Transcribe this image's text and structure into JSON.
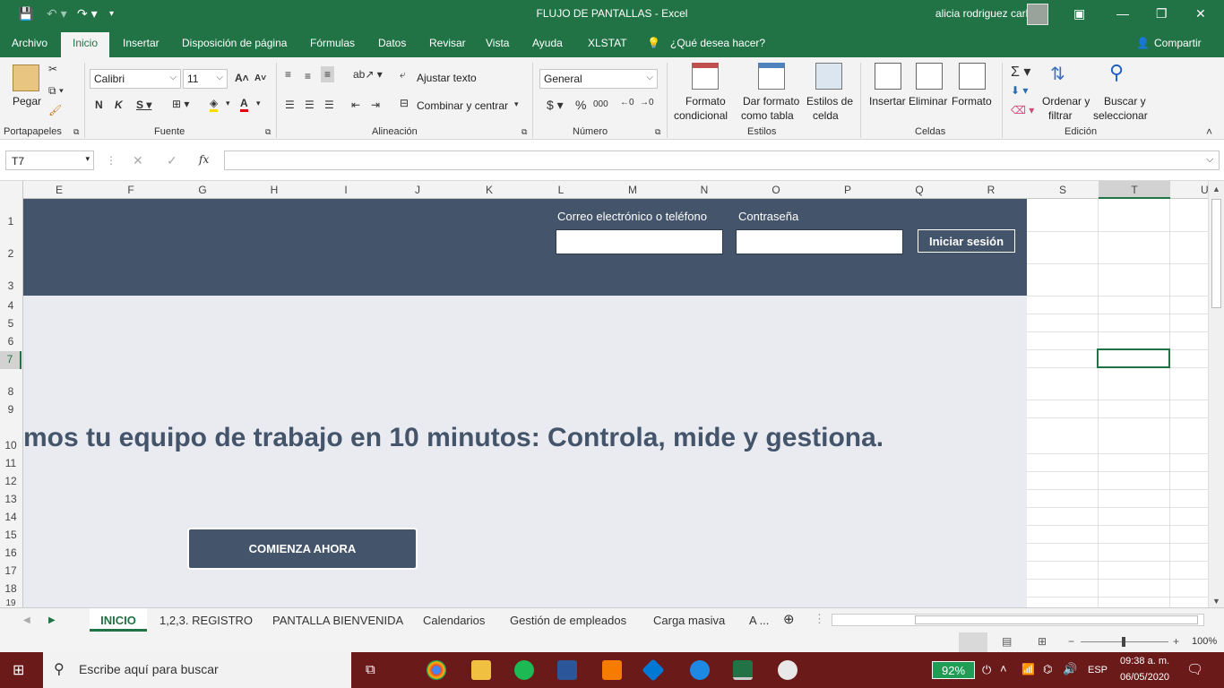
{
  "window": {
    "title": "FLUJO DE PANTALLAS  -  Excel",
    "user": "alicia rodriguez carbajal"
  },
  "menu": {
    "items": [
      "Archivo",
      "Inicio",
      "Insertar",
      "Disposición de página",
      "Fórmulas",
      "Datos",
      "Revisar",
      "Vista",
      "Ayuda",
      "XLSTAT"
    ],
    "search": "¿Qué desea hacer?",
    "share": "Compartir"
  },
  "ribbon": {
    "paste": "Pegar",
    "group_clipboard": "Portapapeles",
    "font_name": "Calibri",
    "font_size": "11",
    "group_font": "Fuente",
    "wrap_text": "Ajustar texto",
    "merge_center": "Combinar y centrar",
    "group_align": "Alineación",
    "number_format": "General",
    "group_number": "Número",
    "cond_format_1": "Formato",
    "cond_format_2": "condicional",
    "table_format_1": "Dar formato",
    "table_format_2": "como tabla",
    "cell_styles_1": "Estilos de",
    "cell_styles_2": "celda",
    "group_styles": "Estilos",
    "insert": "Insertar",
    "delete": "Eliminar",
    "format": "Formato",
    "group_cells": "Celdas",
    "sort_1": "Ordenar y",
    "sort_2": "filtrar",
    "find_1": "Buscar y",
    "find_2": "seleccionar",
    "group_edit": "Edición"
  },
  "formula_bar": {
    "name_box": "T7",
    "value": ""
  },
  "columns": [
    "E",
    "F",
    "G",
    "H",
    "I",
    "J",
    "K",
    "L",
    "M",
    "N",
    "O",
    "P",
    "Q",
    "R",
    "S",
    "T",
    "U"
  ],
  "rows": [
    "1",
    "2",
    "3",
    "4",
    "5",
    "6",
    "7",
    "8",
    "9",
    "10",
    "11",
    "12",
    "13",
    "14",
    "15",
    "16",
    "17",
    "18",
    "19"
  ],
  "sheet": {
    "email_label": "Correo electrónico o teléfono",
    "password_label": "Contraseña",
    "login_button": "Iniciar sesión",
    "headline": "mos tu equipo de trabajo en 10 minutos: Controla, mide y gestiona.",
    "cta": "COMIENZA AHORA",
    "colors": {
      "banner": "#44546a",
      "body": "#e9ebf0",
      "accent": "#217346"
    }
  },
  "sheet_tabs": [
    "INICIO",
    "1,2,3. REGISTRO",
    "PANTALLA BIENVENIDA",
    "Calendarios",
    "Gestión de empleados",
    "Carga masiva",
    "A ..."
  ],
  "status": {
    "zoom": "100%"
  },
  "taskbar": {
    "search": "Escribe aquí para buscar",
    "battery": "92%",
    "lang": "ESP",
    "time": "09:38 a. m.",
    "date": "06/05/2020"
  }
}
